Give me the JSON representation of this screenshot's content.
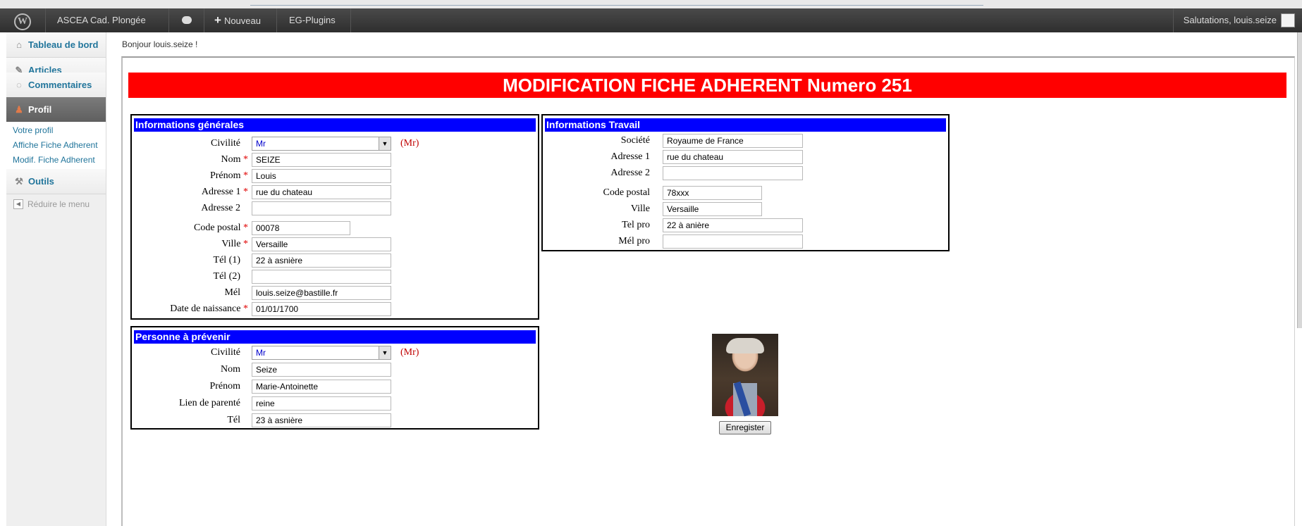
{
  "adminbar": {
    "site_name": "ASCEA Cad. Plongée",
    "new_label": "Nouveau",
    "plugins_label": "EG-Plugins",
    "greeting": "Salutations, louis.seize"
  },
  "sidebar": {
    "items": [
      {
        "label": "Tableau de bord",
        "icon": "dashboard-icon"
      },
      {
        "label": "Articles",
        "icon": "pin-icon"
      },
      {
        "label": "Commentaires",
        "icon": "comment-icon"
      },
      {
        "label": "Profil",
        "icon": "users-icon"
      },
      {
        "label": "Outils",
        "icon": "tools-icon"
      }
    ],
    "submenu": [
      "Votre profil",
      "Affiche Fiche Adherent",
      "Modif. Fiche Adherent"
    ],
    "collapse_label": "Réduire le menu"
  },
  "content": {
    "hello": "Bonjour louis.seize !",
    "banner": "MODIFICATION FICHE ADHERENT Numero 251",
    "save_label": "Enregister"
  },
  "general": {
    "title": "Informations générales",
    "required_mark": "*",
    "labels": {
      "civilite": "Civilité",
      "nom": "Nom",
      "prenom": "Prénom",
      "adresse1": "Adresse 1",
      "adresse2": "Adresse 2",
      "code_postal": "Code postal",
      "ville": "Ville",
      "tel1": "Tél (1)",
      "tel2": "Tél (2)",
      "mel": "Mél",
      "naissance": "Date de naissance"
    },
    "values": {
      "civilite": "Mr",
      "civilite_hint": "(Mr)",
      "nom": "SEIZE",
      "prenom": "Louis",
      "adresse1": "rue du chateau",
      "adresse2": "",
      "code_postal": "00078",
      "ville": "Versaille",
      "tel1": "22 à asnière",
      "tel2": "",
      "mel": "louis.seize@bastille.fr",
      "naissance": "01/01/1700"
    }
  },
  "contact": {
    "title": "Personne à prévenir",
    "labels": {
      "civilite": "Civilité",
      "nom": "Nom",
      "prenom": "Prénom",
      "lien": "Lien de parenté",
      "tel": "Tél"
    },
    "values": {
      "civilite": "Mr",
      "civilite_hint": "(Mr)",
      "nom": "Seize",
      "prenom": "Marie-Antoinette",
      "lien": "reine",
      "tel": "23 à asnière"
    }
  },
  "work": {
    "title": "Informations Travail",
    "labels": {
      "societe": "Société",
      "adresse1": "Adresse 1",
      "adresse2": "Adresse 2",
      "code_postal": "Code postal",
      "ville": "Ville",
      "tel_pro": "Tel pro",
      "mel_pro": "Mél pro"
    },
    "values": {
      "societe": "Royaume de France",
      "adresse1": "rue du chateau",
      "adresse2": "",
      "code_postal": "78xxx",
      "ville": "Versaille",
      "tel_pro": "22 à anière",
      "mel_pro": ""
    }
  },
  "colors": {
    "banner": "#ff0000",
    "section_title": "#0000ff",
    "required": "#e00000",
    "link": "#21759b"
  }
}
